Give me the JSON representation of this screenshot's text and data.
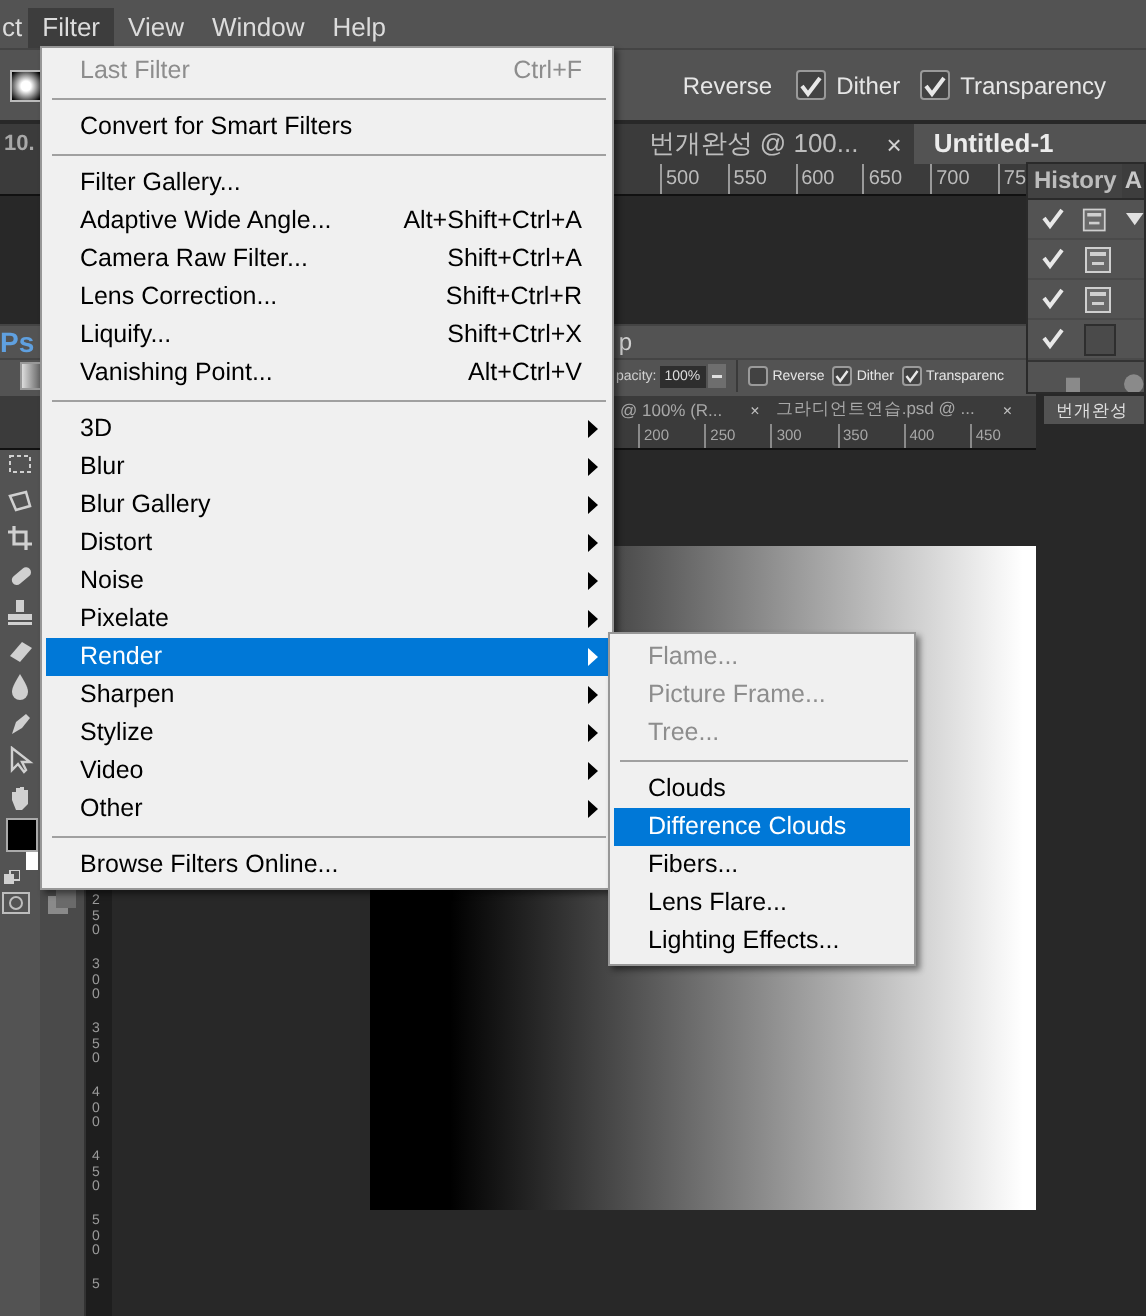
{
  "menubar": [
    {
      "label": "ct",
      "selected": false
    },
    {
      "label": "Filter",
      "selected": true
    },
    {
      "label": "View",
      "selected": false
    },
    {
      "label": "Window",
      "selected": false
    },
    {
      "label": "Help",
      "selected": false
    }
  ],
  "options_bar": {
    "reverse_label": "Reverse",
    "checkboxes": [
      {
        "label": "Dither",
        "checked": true
      },
      {
        "label": "Transparency",
        "checked": true
      }
    ]
  },
  "document_tabs": [
    {
      "label": "10.",
      "selected": false
    },
    {
      "label": "번개완성 @ 100...",
      "close": "×",
      "selected": false
    },
    {
      "label": "Untitled-1",
      "selected": true
    }
  ],
  "ruler": [
    "500",
    "550",
    "600",
    "650",
    "700",
    "75"
  ],
  "history_panel": {
    "tabs": [
      {
        "label": "History",
        "selected": true
      },
      {
        "label": "A",
        "selected": false
      }
    ],
    "rows": [
      {
        "kind": "snapshot",
        "checked": true
      },
      {
        "kind": "snapshot",
        "checked": true
      },
      {
        "kind": "snapshot",
        "checked": true
      },
      {
        "kind": "empty",
        "checked": true
      }
    ]
  },
  "second_window": {
    "app_logo": "Ps",
    "menu_fragment": "p",
    "opacity_label": "pacity:",
    "opacity_value": "100%",
    "checkboxes": [
      {
        "label": "Reverse",
        "checked": false
      },
      {
        "label": "Dither",
        "checked": true
      },
      {
        "label": "Transparenc",
        "checked": true
      }
    ],
    "tabs": [
      {
        "label": "@ 100% (R...",
        "close": "×",
        "selected": false
      },
      {
        "label": "그라디언트연습.psd @ ...",
        "close": "×",
        "selected": false
      },
      {
        "label": "번개완성",
        "selected": true
      }
    ],
    "ruler": [
      "200",
      "250",
      "300",
      "350",
      "400",
      "450"
    ],
    "vertical_ruler": [
      "250",
      "300",
      "350",
      "400",
      "450",
      "500",
      "5"
    ]
  },
  "filter_menu": {
    "groups": [
      [
        {
          "label": "Last Filter",
          "shortcut": "Ctrl+F",
          "disabled": true,
          "submenu": false,
          "selected": false
        }
      ],
      [
        {
          "label": "Convert for Smart Filters",
          "disabled": false,
          "submenu": false,
          "selected": false
        }
      ],
      [
        {
          "label": "Filter Gallery...",
          "disabled": false,
          "submenu": false,
          "selected": false
        },
        {
          "label": "Adaptive Wide Angle...",
          "shortcut": "Alt+Shift+Ctrl+A",
          "disabled": false,
          "submenu": false,
          "selected": false
        },
        {
          "label": "Camera Raw Filter...",
          "shortcut": "Shift+Ctrl+A",
          "disabled": false,
          "submenu": false,
          "selected": false
        },
        {
          "label": "Lens Correction...",
          "shortcut": "Shift+Ctrl+R",
          "disabled": false,
          "submenu": false,
          "selected": false
        },
        {
          "label": "Liquify...",
          "shortcut": "Shift+Ctrl+X",
          "disabled": false,
          "submenu": false,
          "selected": false
        },
        {
          "label": "Vanishing Point...",
          "shortcut": "Alt+Ctrl+V",
          "disabled": false,
          "submenu": false,
          "selected": false
        }
      ],
      [
        {
          "label": "3D",
          "disabled": false,
          "submenu": true,
          "selected": false
        },
        {
          "label": "Blur",
          "disabled": false,
          "submenu": true,
          "selected": false
        },
        {
          "label": "Blur Gallery",
          "disabled": false,
          "submenu": true,
          "selected": false
        },
        {
          "label": "Distort",
          "disabled": false,
          "submenu": true,
          "selected": false
        },
        {
          "label": "Noise",
          "disabled": false,
          "submenu": true,
          "selected": false
        },
        {
          "label": "Pixelate",
          "disabled": false,
          "submenu": true,
          "selected": false
        },
        {
          "label": "Render",
          "disabled": false,
          "submenu": true,
          "selected": true
        },
        {
          "label": "Sharpen",
          "disabled": false,
          "submenu": true,
          "selected": false
        },
        {
          "label": "Stylize",
          "disabled": false,
          "submenu": true,
          "selected": false
        },
        {
          "label": "Video",
          "disabled": false,
          "submenu": true,
          "selected": false
        },
        {
          "label": "Other",
          "disabled": false,
          "submenu": true,
          "selected": false
        }
      ],
      [
        {
          "label": "Browse Filters Online...",
          "disabled": false,
          "submenu": false,
          "selected": false
        }
      ]
    ]
  },
  "render_submenu": {
    "groups": [
      [
        {
          "label": "Flame...",
          "disabled": true,
          "selected": false
        },
        {
          "label": "Picture Frame...",
          "disabled": true,
          "selected": false
        },
        {
          "label": "Tree...",
          "disabled": true,
          "selected": false
        }
      ],
      [
        {
          "label": "Clouds",
          "disabled": false,
          "selected": false
        },
        {
          "label": "Difference Clouds",
          "disabled": false,
          "selected": true
        },
        {
          "label": "Fibers...",
          "disabled": false,
          "selected": false
        },
        {
          "label": "Lens Flare...",
          "disabled": false,
          "selected": false
        },
        {
          "label": "Lighting Effects...",
          "disabled": false,
          "selected": false
        }
      ]
    ]
  }
}
